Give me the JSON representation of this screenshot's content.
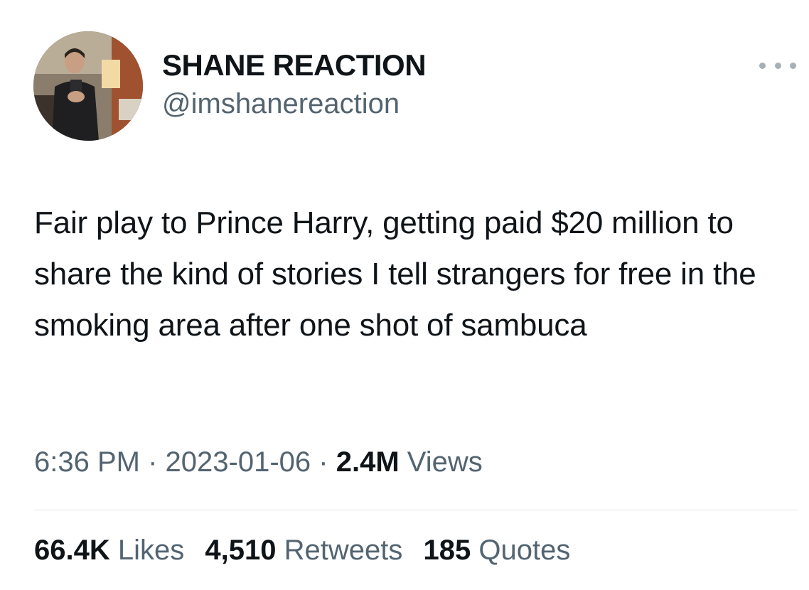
{
  "author": {
    "display_name": "SHANE REACTION",
    "handle": "@imshanereaction"
  },
  "tweet": {
    "text": "Fair play to Prince Harry, getting paid $20 million to share the kind of stories I tell strangers for free in the smoking area after one shot of sambuca"
  },
  "meta": {
    "time": "6:36 PM",
    "separator": "·",
    "date": "2023-01-06",
    "views_count": "2.4M",
    "views_label": "Views"
  },
  "stats": {
    "likes_count": "66.4K",
    "likes_label": "Likes",
    "retweets_count": "4,510",
    "retweets_label": "Retweets",
    "quotes_count": "185",
    "quotes_label": "Quotes"
  },
  "icons": {
    "more": "more-horizontal-icon"
  },
  "colors": {
    "primary_text": "#0f1419",
    "secondary_text": "#536471",
    "divider": "#e3e7ea"
  }
}
